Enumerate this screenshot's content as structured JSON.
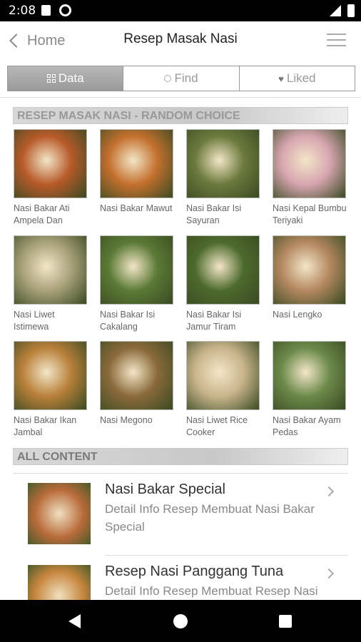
{
  "status": {
    "time": "2:08"
  },
  "appbar": {
    "back_label": "Home",
    "title": "Resep Masak Nasi"
  },
  "tabs": [
    {
      "label": "Data",
      "active": true
    },
    {
      "label": "Find",
      "active": false
    },
    {
      "label": "Liked",
      "active": false
    }
  ],
  "sections": {
    "random": "RESEP MASAK NASI - RANDOM CHOICE",
    "all": "ALL CONTENT"
  },
  "tiles": [
    {
      "caption": "Nasi Bakar Ati Ampela Dan",
      "color": "#b85a2a"
    },
    {
      "caption": "Nasi Bakar Mawut",
      "color": "#c4702e"
    },
    {
      "caption": "Nasi Bakar Isi Sayuran",
      "color": "#6b7a3c"
    },
    {
      "caption": "Nasi Kepal Bumbu Teriyaki",
      "color": "#d7a6b0"
    },
    {
      "caption": "Nasi Liwet Istimewa",
      "color": "#a9a27a"
    },
    {
      "caption": "Nasi Bakar Isi Cakalang",
      "color": "#5b7a35"
    },
    {
      "caption": "Nasi Bakar Isi Jamur Tiram",
      "color": "#4d6a2c"
    },
    {
      "caption": "Nasi Lengko",
      "color": "#b48860"
    },
    {
      "caption": "Nasi Bakar Ikan Jambal",
      "color": "#b9803a"
    },
    {
      "caption": "Nasi Megono",
      "color": "#8a6a3a"
    },
    {
      "caption": "Nasi Liwet Rice Cooker",
      "color": "#c9b58c"
    },
    {
      "caption": "Nasi Bakar Ayam Pedas",
      "color": "#6c8a4a"
    }
  ],
  "list": [
    {
      "title": "Nasi Bakar Special",
      "detail": "Detail Info Resep Membuat Nasi Bakar Special",
      "color": "#b86a3a"
    },
    {
      "title": "Resep Nasi Panggang Tuna",
      "detail": "Detail Info Resep Membuat Resep Nasi",
      "color": "#c7863e"
    }
  ]
}
